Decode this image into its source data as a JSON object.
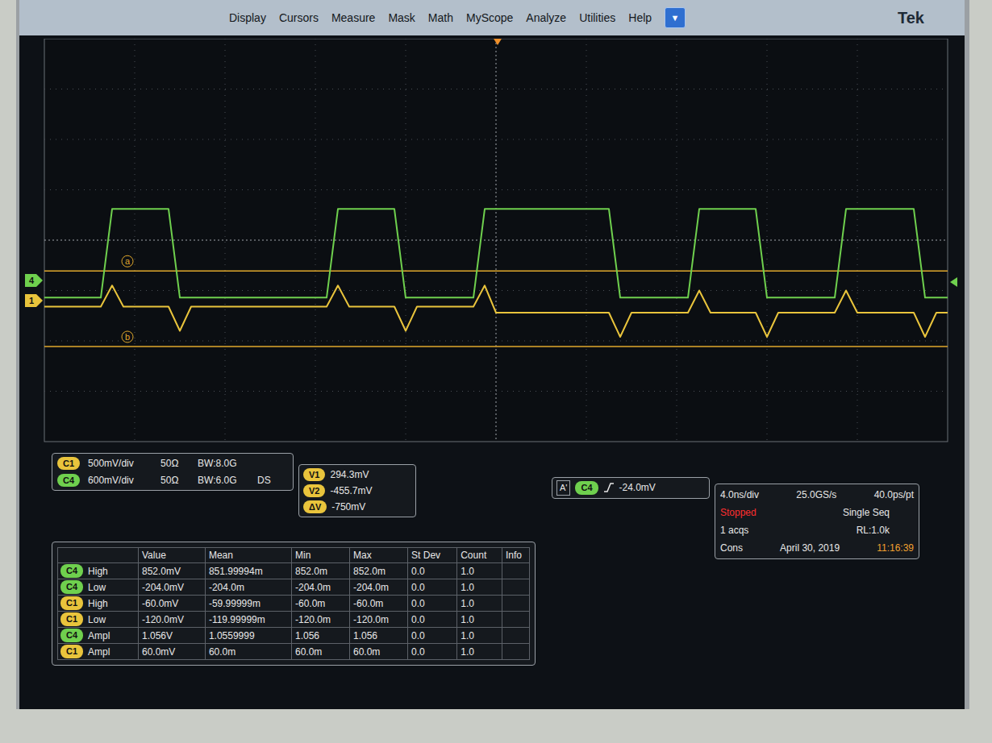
{
  "menu": {
    "items": [
      {
        "label": "Display"
      },
      {
        "label": "Cursors"
      },
      {
        "label": "Measure"
      },
      {
        "label": "Mask"
      },
      {
        "label": "Math"
      },
      {
        "label": "MyScope"
      },
      {
        "label": "Analyze"
      },
      {
        "label": "Utilities"
      },
      {
        "label": "Help"
      }
    ],
    "dropdown": "▼",
    "logo": "Tek"
  },
  "waveform": {
    "series": [
      {
        "name": "C4",
        "marker": "4",
        "color": "#6fd04e",
        "values": [
          -0.204,
          -0.204,
          -0.204,
          -0.204,
          -0.204,
          -0.204,
          0.852,
          0.852,
          0.852,
          0.852,
          0.852,
          0.852,
          -0.204,
          -0.204,
          -0.204,
          -0.204,
          -0.204,
          -0.204,
          -0.204,
          -0.204,
          -0.204,
          -0.204,
          -0.204,
          -0.204,
          -0.204,
          -0.204,
          0.852,
          0.852,
          0.852,
          0.852,
          0.852,
          0.852,
          -0.204,
          -0.204,
          -0.204,
          -0.204,
          -0.204,
          -0.204,
          -0.204,
          0.852,
          0.852,
          0.852,
          0.852,
          0.852,
          0.852,
          0.852,
          0.852,
          0.852,
          0.852,
          0.852,
          0.852,
          -0.204,
          -0.204,
          -0.204,
          -0.204,
          -0.204,
          -0.204,
          -0.204,
          0.852,
          0.852,
          0.852,
          0.852,
          0.852,
          0.852,
          -0.204,
          -0.204,
          -0.204,
          -0.204,
          -0.204,
          -0.204,
          -0.204,
          0.852,
          0.852,
          0.852,
          0.852,
          0.852,
          0.852,
          0.852,
          -0.204,
          -0.204,
          -0.204
        ]
      },
      {
        "name": "C1",
        "marker": "1",
        "color": "#e9c43c",
        "values": [
          -0.06,
          -0.06,
          -0.06,
          -0.06,
          -0.06,
          -0.06,
          0.15,
          -0.06,
          -0.06,
          -0.06,
          -0.06,
          -0.06,
          -0.3,
          -0.06,
          -0.06,
          -0.06,
          -0.06,
          -0.06,
          -0.06,
          -0.06,
          -0.06,
          -0.06,
          -0.06,
          -0.06,
          -0.06,
          -0.06,
          0.15,
          -0.06,
          -0.06,
          -0.06,
          -0.06,
          -0.06,
          -0.3,
          -0.06,
          -0.06,
          -0.06,
          -0.06,
          -0.06,
          -0.06,
          0.15,
          -0.12,
          -0.12,
          -0.12,
          -0.12,
          -0.12,
          -0.12,
          -0.12,
          -0.12,
          -0.12,
          -0.12,
          -0.12,
          -0.36,
          -0.12,
          -0.12,
          -0.12,
          -0.12,
          -0.12,
          -0.12,
          0.1,
          -0.12,
          -0.12,
          -0.12,
          -0.12,
          -0.12,
          -0.36,
          -0.12,
          -0.12,
          -0.12,
          -0.12,
          -0.12,
          -0.12,
          0.1,
          -0.12,
          -0.12,
          -0.12,
          -0.12,
          -0.12,
          -0.12,
          -0.36,
          -0.12,
          -0.12
        ]
      }
    ],
    "cursors": [
      {
        "label": "a",
        "value": 0.2943
      },
      {
        "label": "b",
        "value": -0.4557
      }
    ]
  },
  "channels": [
    {
      "name": "C1",
      "color": "#e9c43c",
      "scale": "500mV/div",
      "impedance": "50Ω",
      "bandwidth": "BW:8.0G"
    },
    {
      "name": "C4",
      "color": "#6fd04e",
      "scale": "600mV/div",
      "impedance": "50Ω",
      "bandwidth": "BW:6.0G",
      "extra": "DS"
    }
  ],
  "cursor_readout": [
    {
      "label": "V1",
      "value": "294.3mV"
    },
    {
      "label": "V2",
      "value": "-455.7mV"
    },
    {
      "label": "ΔV",
      "value": "-750mV"
    }
  ],
  "trigger": {
    "label": "A'",
    "source": "C4",
    "color": "#6fd04e",
    "level": "-24.0mV"
  },
  "acquisition": {
    "time_per_div": "4.0ns/div",
    "sample_rate": "25.0GS/s",
    "resolution": "40.0ps/pt",
    "state": "Stopped",
    "mode": "Single Seq",
    "acqs": "1 acqs",
    "record_length": "RL:1.0k",
    "cons": "Cons",
    "date": "April 30, 2019",
    "time": "11:16:39"
  },
  "measurements": {
    "columns": [
      "Value",
      "Mean",
      "Min",
      "Max",
      "St Dev",
      "Count",
      "Info"
    ],
    "rows": [
      {
        "source": "C4",
        "color": "#6fd04e",
        "name": "High",
        "cells": [
          "852.0mV",
          "851.99994m",
          "852.0m",
          "852.0m",
          "0.0",
          "1.0"
        ]
      },
      {
        "source": "C4",
        "color": "#6fd04e",
        "name": "Low",
        "cells": [
          "-204.0mV",
          "-204.0m",
          "-204.0m",
          "-204.0m",
          "0.0",
          "1.0"
        ]
      },
      {
        "source": "C1",
        "color": "#e9c43c",
        "name": "High",
        "cells": [
          "-60.0mV",
          "-59.99999m",
          "-60.0m",
          "-60.0m",
          "0.0",
          "1.0"
        ]
      },
      {
        "source": "C1",
        "color": "#e9c43c",
        "name": "Low",
        "cells": [
          "-120.0mV",
          "-119.99999m",
          "-120.0m",
          "-120.0m",
          "0.0",
          "1.0"
        ]
      },
      {
        "source": "C4",
        "color": "#6fd04e",
        "name": "Ampl",
        "cells": [
          "1.056V",
          "1.0559999",
          "1.056",
          "1.056",
          "0.0",
          "1.0"
        ]
      },
      {
        "source": "C1",
        "color": "#e9c43c",
        "name": "Ampl",
        "cells": [
          "60.0mV",
          "60.0m",
          "60.0m",
          "60.0m",
          "0.0",
          "1.0"
        ]
      }
    ]
  }
}
